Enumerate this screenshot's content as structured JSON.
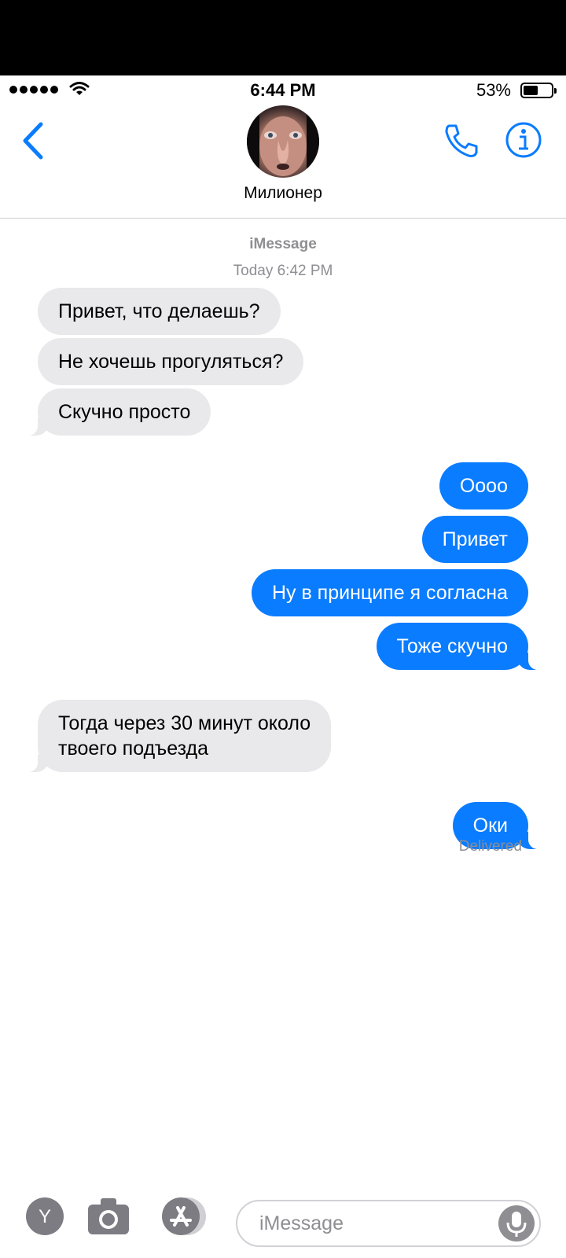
{
  "status_bar": {
    "time": "6:44 PM",
    "battery_percent": "53%",
    "battery_level": 0.53
  },
  "header": {
    "contact_name": "Милионер"
  },
  "thread": {
    "service": "iMessage",
    "timestamp": "Today 6:42 PM",
    "delivered": "Delivered"
  },
  "messages": [
    {
      "from": "them",
      "text": "Привет, что делаешь?"
    },
    {
      "from": "them",
      "text": "Не хочешь прогуляться?"
    },
    {
      "from": "them",
      "text": "Скучно просто"
    },
    {
      "from": "me",
      "text": "Оооо"
    },
    {
      "from": "me",
      "text": "Привет"
    },
    {
      "from": "me",
      "text": "Ну в принципе я согласна"
    },
    {
      "from": "me",
      "text": "Тоже скучно"
    },
    {
      "from": "them",
      "text": "Тогда через 30 минут около"
    },
    {
      "from": "them",
      "text": "твоего подъезда"
    },
    {
      "from": "me",
      "text": "Оки"
    }
  ],
  "composer": {
    "placeholder": "iMessage",
    "app_icon_letter": "Y"
  },
  "colors": {
    "accent": "#0a7cff",
    "incoming_bubble": "#e9e9eb",
    "meta_text": "#8e8e93"
  },
  "icons": [
    "back-chevron-icon",
    "phone-icon",
    "info-icon",
    "camera-icon",
    "app-store-icon",
    "microphone-icon",
    "wifi-icon",
    "battery-icon"
  ]
}
